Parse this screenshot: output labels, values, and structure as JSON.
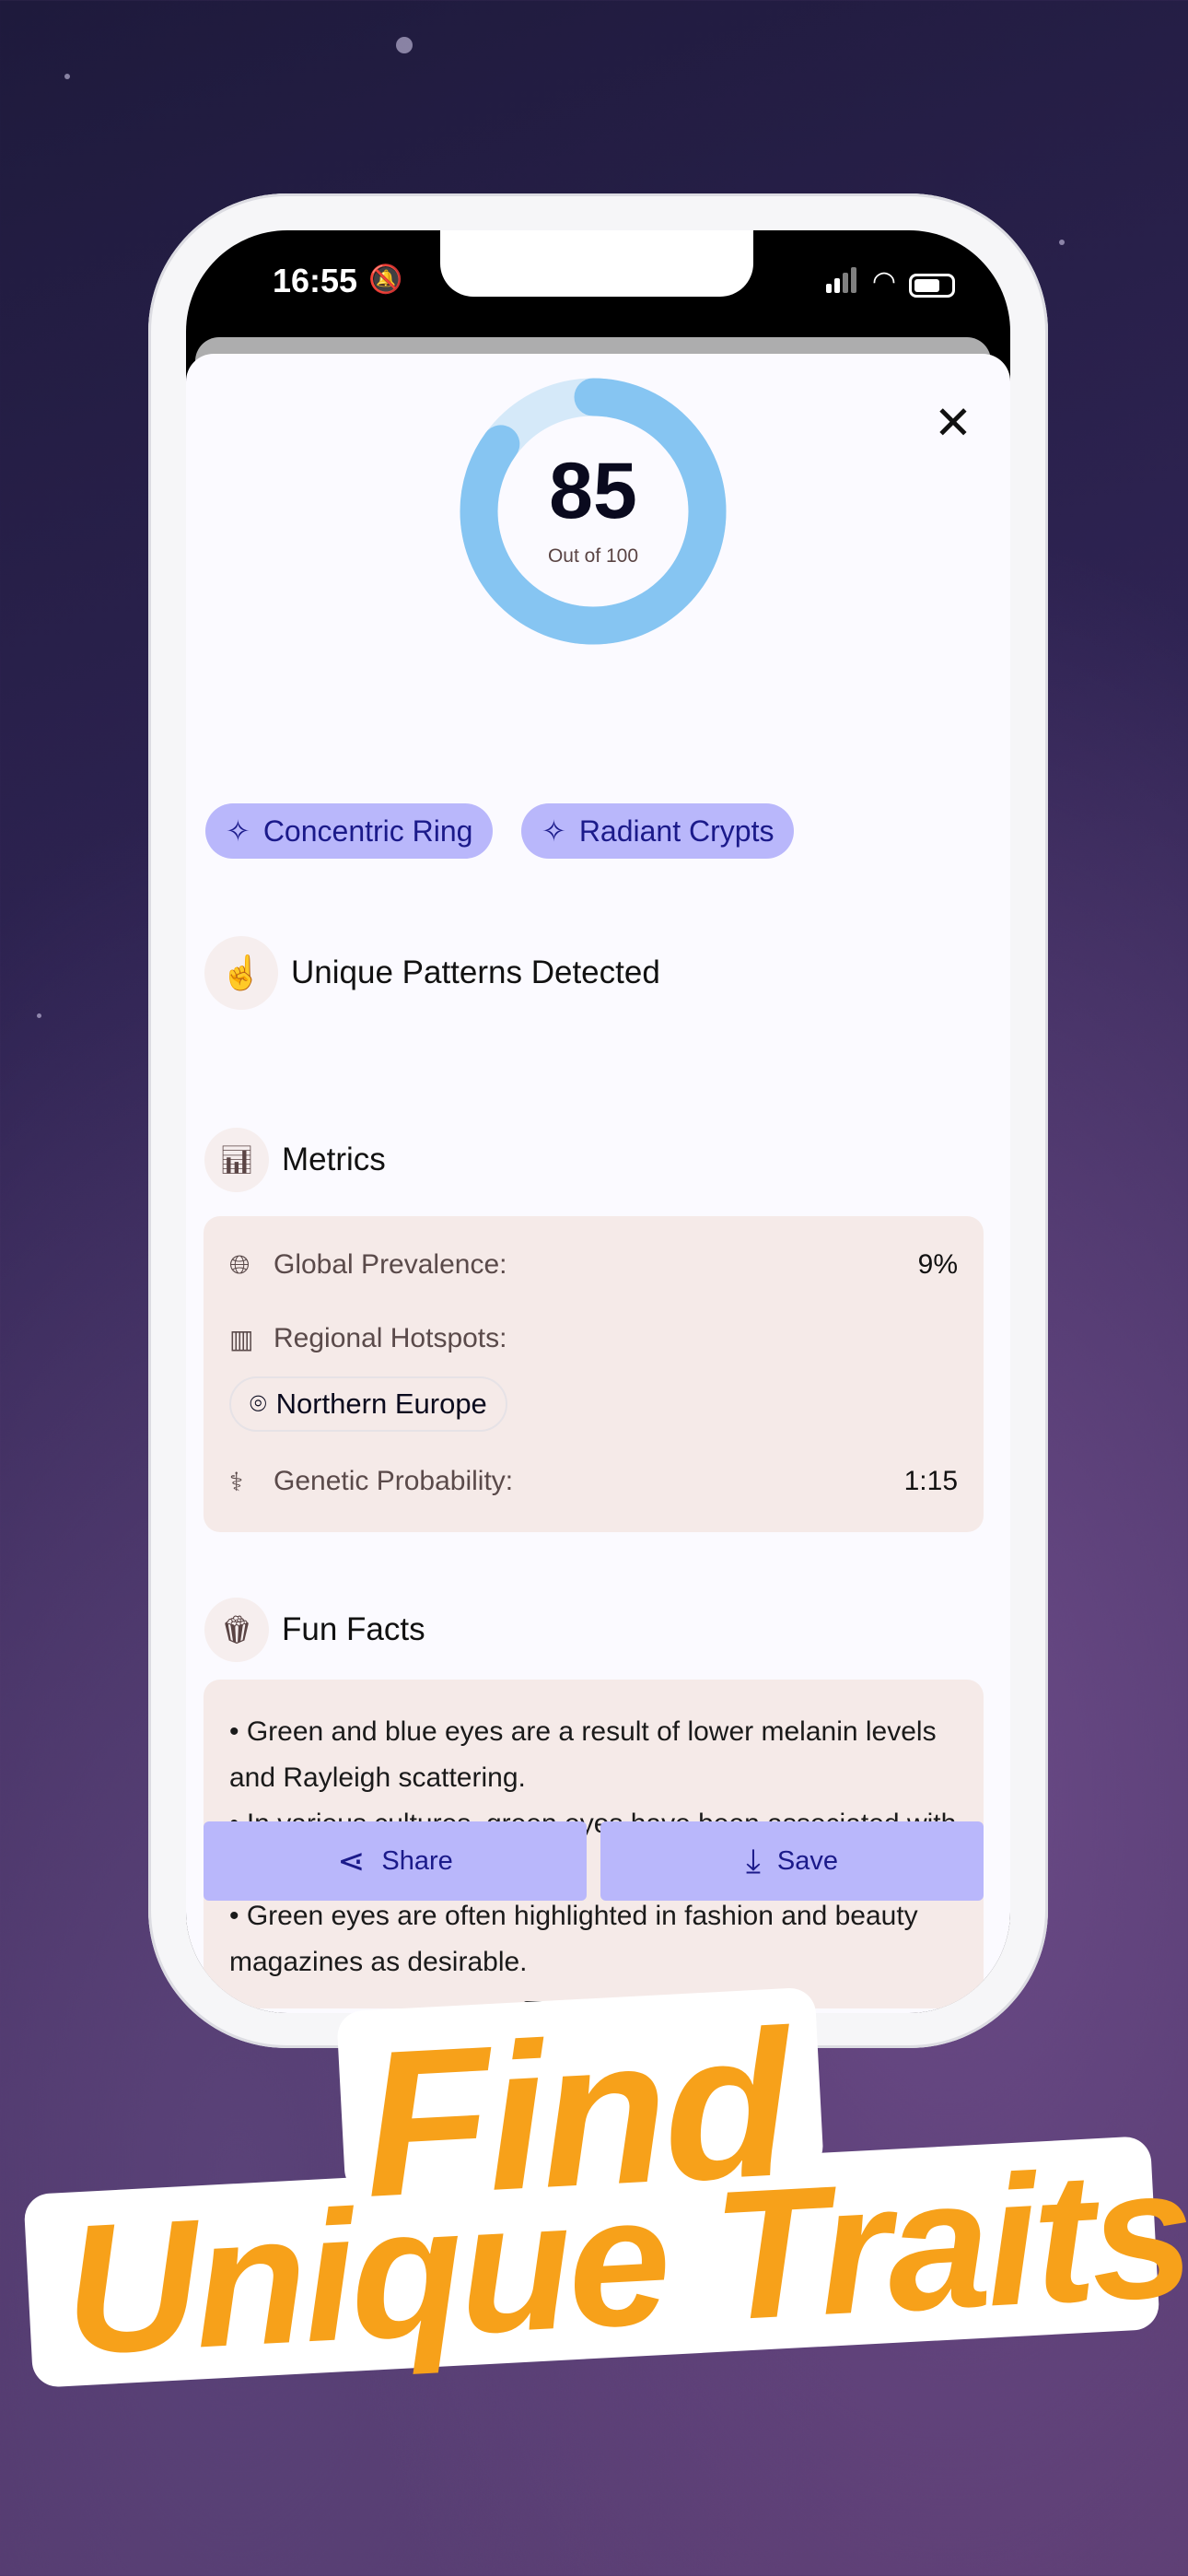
{
  "status_bar": {
    "time": "16:55"
  },
  "score": {
    "value": "85",
    "subtitle": "Out of 100",
    "fraction": 0.85
  },
  "patterns": {
    "title": "Unique Patterns Detected",
    "chips": [
      "Concentric Ring",
      "Radiant Crypts"
    ]
  },
  "metrics": {
    "title": "Metrics",
    "global_label": "Global Prevalence:",
    "global_value": "9%",
    "regional_label": "Regional Hotspots:",
    "region": "Northern Europe",
    "genetic_label": "Genetic Probability:",
    "genetic_value": "1:15"
  },
  "fun_facts": {
    "title": "Fun Facts",
    "items": [
      "• Green and blue eyes are a result of lower melanin levels and Rayleigh scattering.",
      "• In various cultures, green eyes have been associated with supernatural abilities.",
      "• Green eyes are often highlighted in fashion and beauty magazines as desirable."
    ]
  },
  "actions": {
    "share": "Share",
    "save": "Save"
  },
  "headline": {
    "line1": "Find",
    "line2": "Unique Traits"
  },
  "colors": {
    "accent": "#b9b7fb",
    "ring": "#86c5f2",
    "ring_track": "#d5e9f9",
    "headline": "#f7a11a"
  }
}
